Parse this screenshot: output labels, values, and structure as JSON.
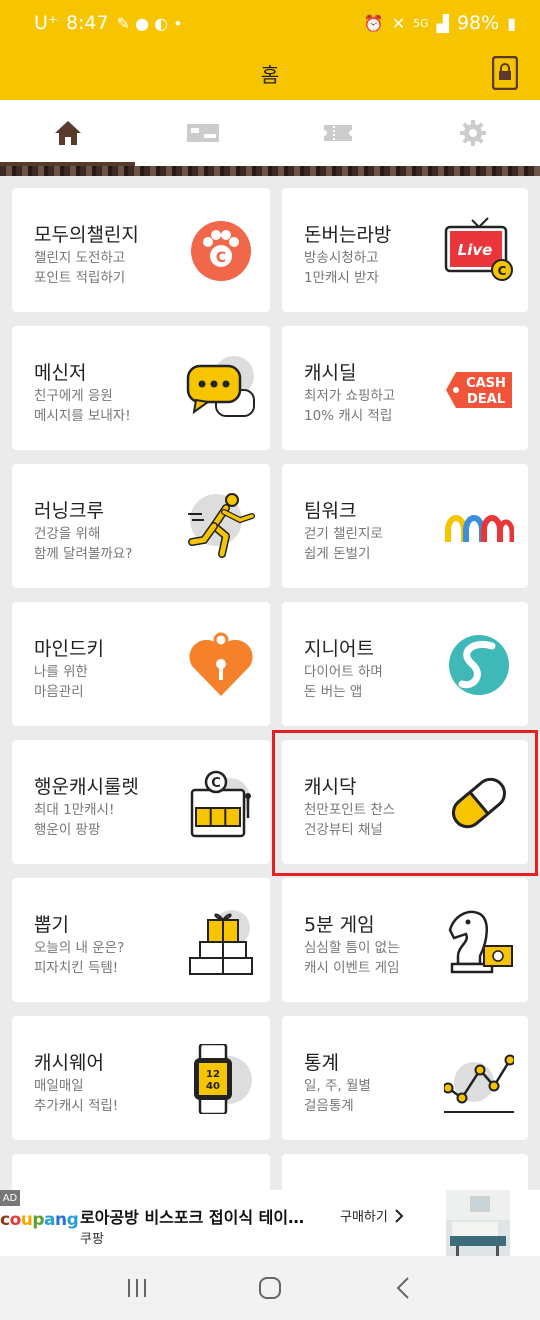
{
  "status": {
    "carrier": "U⁺",
    "time": "8:47",
    "battery": "98%",
    "network": "5G"
  },
  "header": {
    "title": "홈"
  },
  "tabs": [
    {
      "icon": "home-icon",
      "active": true
    },
    {
      "icon": "ticket-icon",
      "active": false
    },
    {
      "icon": "coupon-icon",
      "active": false
    },
    {
      "icon": "gear-icon",
      "active": false
    }
  ],
  "cards": [
    {
      "title": "모두의챌린지",
      "desc": "챌린지 도전하고\n포인트 적립하기",
      "icon": "paw-coin-icon"
    },
    {
      "title": "돈버는라방",
      "desc": "방송시청하고\n1만캐시 받자",
      "icon": "live-tv-icon"
    },
    {
      "title": "메신저",
      "desc": "친구에게 응원\n메시지를 보내자!",
      "icon": "chat-bubble-icon"
    },
    {
      "title": "캐시딜",
      "desc": "최저가 쇼핑하고\n10% 캐시 적립",
      "icon": "cash-deal-icon"
    },
    {
      "title": "러닝크루",
      "desc": "건강을 위해\n함께 달려볼까요?",
      "icon": "runner-icon"
    },
    {
      "title": "팀워크",
      "desc": "걷기 챌린지로\n쉽게 돈벌기",
      "icon": "teamwork-arches-icon"
    },
    {
      "title": "마인드키",
      "desc": "나를 위한\n마음관리",
      "icon": "heart-lock-icon"
    },
    {
      "title": "지니어트",
      "desc": "다이어트 하며\n돈 버는 앱",
      "icon": "s-logo-icon"
    },
    {
      "title": "행운캐시룰렛",
      "desc": "최대 1만캐시!\n행운이 팡팡",
      "icon": "slot-machine-icon"
    },
    {
      "title": "캐시닥",
      "desc": "천만포인트 찬스\n건강뷰티 채널",
      "icon": "pill-icon"
    },
    {
      "title": "뽑기",
      "desc": "오늘의 내 운은?\n피자치킨 득템!",
      "icon": "gift-boxes-icon"
    },
    {
      "title": "5분 게임",
      "desc": "심심할 틈이 없는\n캐시 이벤트 게임",
      "icon": "chess-knight-icon"
    },
    {
      "title": "캐시웨어",
      "desc": "매일매일\n추가캐시 적립!",
      "icon": "smartwatch-icon"
    },
    {
      "title": "통계",
      "desc": "일, 주, 월별\n걸음통계",
      "icon": "line-graph-icon"
    },
    {
      "title": "",
      "desc": "",
      "icon": "partial-card-icon"
    },
    {
      "title": "",
      "desc": "",
      "icon": "partial-card-icon"
    }
  ],
  "ad": {
    "tag": "AD",
    "brand": "coupang",
    "title": "로아공방 비스포크 접이식 테이…",
    "subtitle": "쿠팡",
    "cta": "구매하기"
  },
  "colors": {
    "accent": "#f7c500",
    "highlight": "#e52024",
    "icon_orange": "#f5822a"
  }
}
